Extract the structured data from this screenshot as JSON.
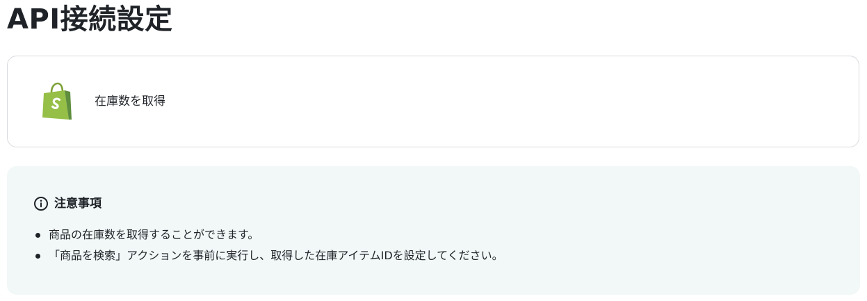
{
  "page": {
    "title": "API接続設定"
  },
  "action": {
    "icon": "shopify-bag-icon",
    "label": "在庫数を取得",
    "brand_color": "#95bf47"
  },
  "notice": {
    "icon": "info-circle-icon",
    "title": "注意事項",
    "background": "#f1f8f7",
    "items": [
      "商品の在庫数を取得することができます。",
      "「商品を検索」アクションを事前に実行し、取得した在庫アイテムIDを設定してください。"
    ]
  }
}
